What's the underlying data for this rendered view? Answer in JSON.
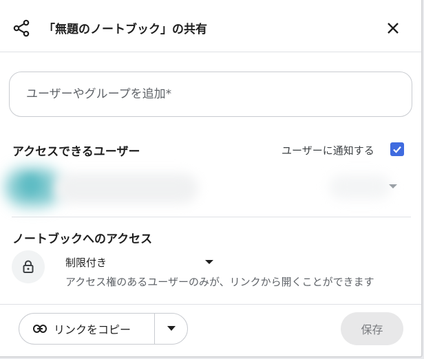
{
  "dialog": {
    "title": "「無題のノートブック」の共有"
  },
  "search": {
    "placeholder": "ユーザーやグループを追加*"
  },
  "people_section": {
    "title": "アクセスできるユーザー",
    "notify_label": "ユーザーに通知する",
    "notify_checked": true
  },
  "access_section": {
    "title": "ノートブックへのアクセス",
    "selected": "制限付き",
    "description": "アクセス権のあるユーザーのみが、リンクから開くことができます"
  },
  "footer": {
    "copy_link_label": "リンクをコピー",
    "save_label": "保存"
  },
  "icons": {
    "share": "share-icon",
    "close": "close-icon",
    "checkbox": "checkmark-icon",
    "lock": "lock-icon",
    "link": "link-icon",
    "dropdown": "caret-down-icon"
  },
  "colors": {
    "accent": "#3f6bdf",
    "text": "#1f1f1f",
    "muted": "#5f6368",
    "save_bg": "#e8e8e9"
  }
}
